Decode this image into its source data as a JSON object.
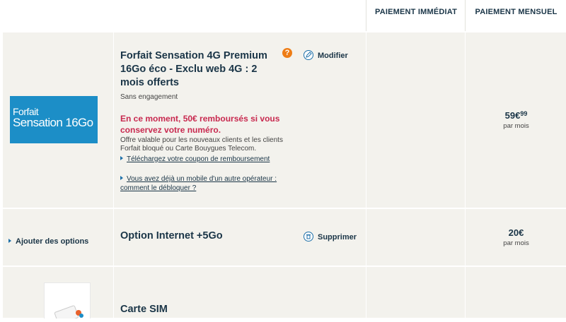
{
  "columns": {
    "immediate": "PAIEMENT IMMÉDIAT",
    "monthly": "PAIEMENT MENSUEL"
  },
  "plan": {
    "logo_line1": "Forfait",
    "logo_line2": "Sensation 16Go",
    "title": "Forfait Sensation 4G Premium 16Go éco - Exclu web 4G : 2 mois offerts",
    "help_icon": "?",
    "modify_label": "Modifier",
    "commitment": "Sans engagement",
    "promo": "En ce moment, 50€ remboursés si vous conservez votre numéro.",
    "offer_text": "Offre valable pour les nouveaux clients et les clients Forfait bloqué ou Carte Bouygues Telecom.",
    "coupon_link": "Téléchargez votre coupon de remboursement",
    "unlock_link": "Vous avez déjà un mobile d'un autre opérateur : comment le débloquer ?",
    "price_main": "59€",
    "price_cents": "99",
    "price_period": "par mois"
  },
  "option": {
    "add_options_label": "Ajouter des options",
    "title": "Option Internet +5Go",
    "remove_label": "Supprimer",
    "price": "20€",
    "price_period": "par mois"
  },
  "sim": {
    "title": "Carte SIM"
  },
  "colors": {
    "accent_blue": "#1c8ec7",
    "promo_red": "#c8294f",
    "help_orange": "#ee7d16",
    "row_bg": "#f3f2ed"
  }
}
